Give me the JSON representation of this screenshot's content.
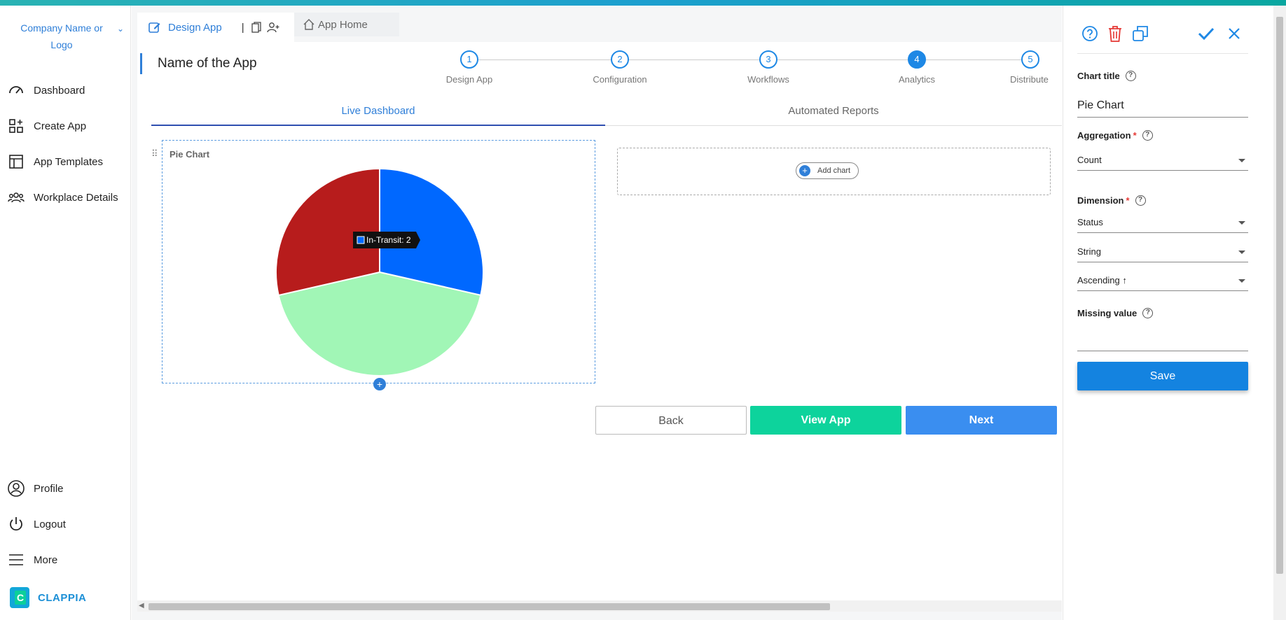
{
  "brand": {
    "name": "Company Name or Logo",
    "footer_logo": "CLAPPIA"
  },
  "sidebar": {
    "items": [
      {
        "label": "Dashboard",
        "icon": "dashboard-gauge-icon"
      },
      {
        "label": "Create App",
        "icon": "create-app-icon"
      },
      {
        "label": "App Templates",
        "icon": "templates-icon"
      },
      {
        "label": "Workplace Details",
        "icon": "users-icon"
      }
    ],
    "bottom": [
      {
        "label": "Profile",
        "icon": "profile-icon"
      },
      {
        "label": "Logout",
        "icon": "power-icon"
      },
      {
        "label": "More",
        "icon": "menu-icon"
      }
    ]
  },
  "tabs": {
    "design": "Design App",
    "home": "App Home"
  },
  "app": {
    "name": "Name of the App"
  },
  "steps": [
    {
      "num": "1",
      "label": "Design App"
    },
    {
      "num": "2",
      "label": "Configuration"
    },
    {
      "num": "3",
      "label": "Workflows"
    },
    {
      "num": "4",
      "label": "Analytics"
    },
    {
      "num": "5",
      "label": "Distribute"
    }
  ],
  "subtabs": {
    "live": "Live Dashboard",
    "reports": "Automated Reports"
  },
  "chart_card": {
    "title": "Pie Chart",
    "add_chart": "Add chart"
  },
  "chart_data": {
    "type": "pie",
    "title": "Pie Chart",
    "slices": [
      {
        "name": "In-Transit",
        "value": 2,
        "color": "#0068ff"
      },
      {
        "name": "",
        "value": 3,
        "color": "#a1f6b6"
      },
      {
        "name": "",
        "value": 2,
        "color": "#b71c1c"
      }
    ],
    "tooltip": "In-Transit: 2"
  },
  "buttons": {
    "back": "Back",
    "view": "View App",
    "next": "Next"
  },
  "panel": {
    "chart_title_label": "Chart title",
    "chart_title_value": "Pie Chart",
    "aggregation_label": "Aggregation",
    "aggregation_value": "Count",
    "dimension_label": "Dimension",
    "dimension_value": "Status",
    "type_value": "String",
    "sort_value": "Ascending ↑",
    "missing_label": "Missing value",
    "missing_value": "",
    "save": "Save",
    "required_mark": "*",
    "help_mark": "?"
  },
  "colors": {
    "accent": "#2f7fd8",
    "view": "#0dd39c",
    "next": "#3a8ef0",
    "save": "#1483e0"
  }
}
